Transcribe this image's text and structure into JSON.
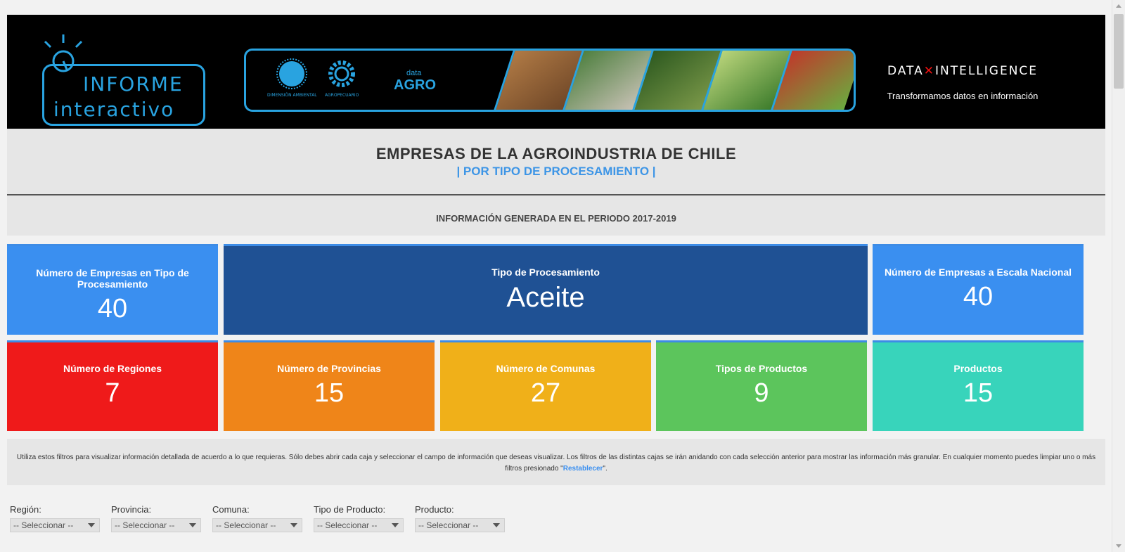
{
  "header": {
    "logo_line1": "INFORME",
    "logo_line2": "interactivo",
    "banner": {
      "logo1_label": "DIMENSIÓN AMBIENTAL",
      "logo2_label": "AGROPECUARIO",
      "dataagro_small": "data",
      "dataagro_big": "AGRO"
    },
    "brand_left": "DATA",
    "brand_right": "INTELLIGENCE",
    "tagline": "Transformamos datos en información"
  },
  "title": "EMPRESAS DE LA AGROINDUSTRIA DE CHILE",
  "subtitle": "| POR TIPO DE PROCESAMIENTO |",
  "period": "INFORMACIÓN GENERADA EN EL PERIODO 2017-2019",
  "kpis": {
    "empresas_tipo": {
      "label": "Número de Empresas en Tipo de Procesamiento",
      "value": "40"
    },
    "tipo": {
      "label": "Tipo de Procesamiento",
      "value": "Aceite"
    },
    "empresas_nacional": {
      "label": "Número de Empresas a Escala Nacional",
      "value": "40"
    },
    "regiones": {
      "label": "Número de Regiones",
      "value": "7"
    },
    "provincias": {
      "label": "Número de Provincias",
      "value": "15"
    },
    "comunas": {
      "label": "Número de Comunas",
      "value": "27"
    },
    "tipos_productos": {
      "label": "Tipos de Productos",
      "value": "9"
    },
    "productos": {
      "label": "Productos",
      "value": "15"
    }
  },
  "info": {
    "text": "Utiliza estos filtros para visualizar información detallada de acuerdo a lo que requieras. Sólo debes abrir cada caja y seleccionar el campo de información que deseas visualizar. Los filtros de las distintas cajas se irán anidando con cada selección anterior para mostrar las información más granular. En cualquier momento puedes limpiar uno o más filtros presionado \"",
    "link": "Restablecer",
    "tail": "\"."
  },
  "filters": [
    {
      "label": "Región:",
      "value": "-- Seleccionar --"
    },
    {
      "label": "Provincia:",
      "value": "-- Seleccionar --"
    },
    {
      "label": "Comuna:",
      "value": "-- Seleccionar --"
    },
    {
      "label": "Tipo de Producto:",
      "value": "-- Seleccionar --"
    },
    {
      "label": "Producto:",
      "value": "-- Seleccionar --"
    }
  ],
  "colors": {
    "blue": "#3a8ff0",
    "navy": "#1f5194",
    "red": "#ef1a1a",
    "orange": "#ef8519",
    "yellow": "#f0b019",
    "green": "#5cc55c",
    "teal": "#38d4bb",
    "accent": "#29a3e0"
  }
}
